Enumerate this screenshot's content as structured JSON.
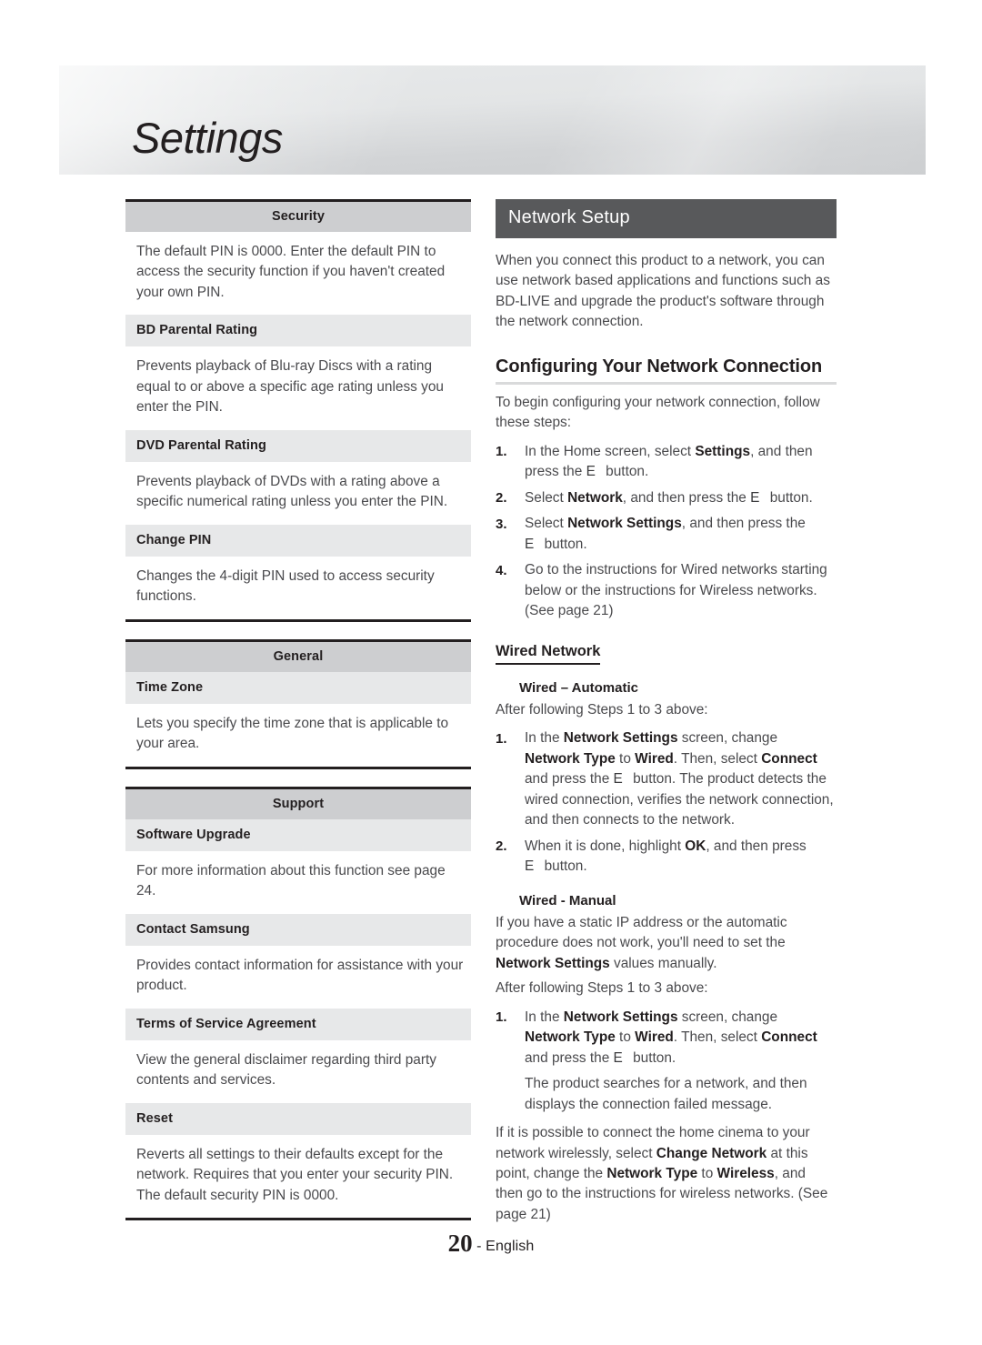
{
  "page": {
    "chapter_title": "Settings",
    "footer_page_number": "20",
    "footer_separator": " - ",
    "footer_language": "English"
  },
  "left_column": {
    "tables": [
      {
        "group_header": "Security",
        "rows": [
          {
            "type": "body",
            "text": "The default PIN is 0000. Enter the default PIN to access the security function if you haven't created your own PIN."
          },
          {
            "type": "sub_header",
            "text": "BD Parental Rating"
          },
          {
            "type": "body",
            "text": "Prevents playback of Blu-ray Discs with a rating equal to or above a specific age rating unless you enter the PIN."
          },
          {
            "type": "sub_header",
            "text": "DVD Parental Rating"
          },
          {
            "type": "body",
            "text": "Prevents playback of DVDs with a rating above a specific numerical rating unless you enter the PIN."
          },
          {
            "type": "sub_header",
            "text": "Change PIN"
          },
          {
            "type": "body",
            "text": "Changes the 4-digit PIN used to access security functions."
          }
        ]
      },
      {
        "group_header": "General",
        "rows": [
          {
            "type": "sub_header",
            "text": "Time Zone"
          },
          {
            "type": "body",
            "text": "Lets you specify the time zone that is applicable to your area."
          }
        ]
      },
      {
        "group_header": "Support",
        "rows": [
          {
            "type": "sub_header",
            "text": "Software Upgrade"
          },
          {
            "type": "body",
            "text": "For more information about this function see page 24."
          },
          {
            "type": "sub_header",
            "text": "Contact Samsung"
          },
          {
            "type": "body",
            "text": "Provides contact information for assistance with your product."
          },
          {
            "type": "sub_header",
            "text": "Terms of Service Agreement"
          },
          {
            "type": "body",
            "text": "View the general disclaimer regarding third party contents and services."
          },
          {
            "type": "sub_header",
            "text": "Reset"
          },
          {
            "type": "body",
            "text": "Reverts all settings to their defaults except for the network. Requires that you enter your security PIN. The default security PIN is 0000."
          }
        ]
      }
    ]
  },
  "right_column": {
    "section_banner": "Network Setup",
    "intro_paragraph": "When you connect this product to a network, you can use network based applications and functions such as BD-LIVE and upgrade the product's software through the network connection.",
    "configuring": {
      "heading": "Configuring Your Network Connection",
      "lead_in": "To begin configuring your network connection, follow these steps:",
      "steps": [
        {
          "num": "1.",
          "rich": [
            {
              "t": "In the Home screen, select "
            },
            {
              "t": "Settings",
              "b": true
            },
            {
              "t": ", and then press the "
            },
            {
              "t": "E",
              "key": true
            },
            {
              "t": "button."
            }
          ]
        },
        {
          "num": "2.",
          "rich": [
            {
              "t": "Select "
            },
            {
              "t": "Network",
              "b": true
            },
            {
              "t": ", and then press the "
            },
            {
              "t": "E",
              "key": true
            },
            {
              "t": "button."
            }
          ]
        },
        {
          "num": "3.",
          "rich": [
            {
              "t": "Select "
            },
            {
              "t": "Network Settings",
              "b": true
            },
            {
              "t": ", and then press the "
            },
            {
              "t": "E",
              "key": true
            },
            {
              "t": "button."
            }
          ]
        },
        {
          "num": "4.",
          "rich": [
            {
              "t": "Go to the instructions for Wired networks starting below or the instructions for Wireless networks. (See page 21)"
            }
          ]
        }
      ]
    },
    "wired_network": {
      "heading": "Wired Network",
      "automatic": {
        "heading": "Wired – Automatic",
        "lead_in": "After following Steps 1 to 3 above:",
        "steps": [
          {
            "num": "1.",
            "rich": [
              {
                "t": "In the "
              },
              {
                "t": "Network Settings",
                "b": true
              },
              {
                "t": " screen, change "
              },
              {
                "t": "Network Type",
                "b": true
              },
              {
                "t": " to "
              },
              {
                "t": "Wired",
                "b": true
              },
              {
                "t": ". Then, select "
              },
              {
                "t": "Connect",
                "b": true
              },
              {
                "t": " and press the "
              },
              {
                "t": "E",
                "key": true
              },
              {
                "t": "button. The product detects the wired connection, verifies the network connection, and then connects to the network."
              }
            ]
          },
          {
            "num": "2.",
            "rich": [
              {
                "t": "When it is done, highlight "
              },
              {
                "t": "OK",
                "b": true
              },
              {
                "t": ", and then press "
              },
              {
                "t": "E",
                "key": true
              },
              {
                "t": "button."
              }
            ]
          }
        ]
      },
      "manual": {
        "heading": "Wired - Manual",
        "intro_rich": [
          {
            "t": "If you have a static IP address or the automatic procedure does not work, you'll need to set the "
          },
          {
            "t": "Network Settings",
            "b": true
          },
          {
            "t": " values manually."
          }
        ],
        "lead_in": "After following Steps 1 to 3 above:",
        "steps": [
          {
            "num": "1.",
            "rich": [
              {
                "t": "In the "
              },
              {
                "t": "Network Settings",
                "b": true
              },
              {
                "t": " screen, change "
              },
              {
                "t": "Network Type",
                "b": true
              },
              {
                "t": " to "
              },
              {
                "t": "Wired",
                "b": true
              },
              {
                "t": ". Then, select "
              },
              {
                "t": "Connect",
                "b": true
              },
              {
                "t": " and press the "
              },
              {
                "t": "E",
                "key": true
              },
              {
                "t": "button."
              }
            ],
            "note": "The product searches for a network, and then displays the connection failed message."
          }
        ],
        "closing_rich": [
          {
            "t": "If it is possible to connect the home cinema to your network wirelessly, select "
          },
          {
            "t": "Change Network",
            "b": true
          },
          {
            "t": " at this point, change the "
          },
          {
            "t": "Network Type",
            "b": true
          },
          {
            "t": " to "
          },
          {
            "t": "Wireless",
            "b": true
          },
          {
            "t": ", and then go to the instructions for wireless networks. (See page 21)"
          }
        ]
      }
    }
  }
}
